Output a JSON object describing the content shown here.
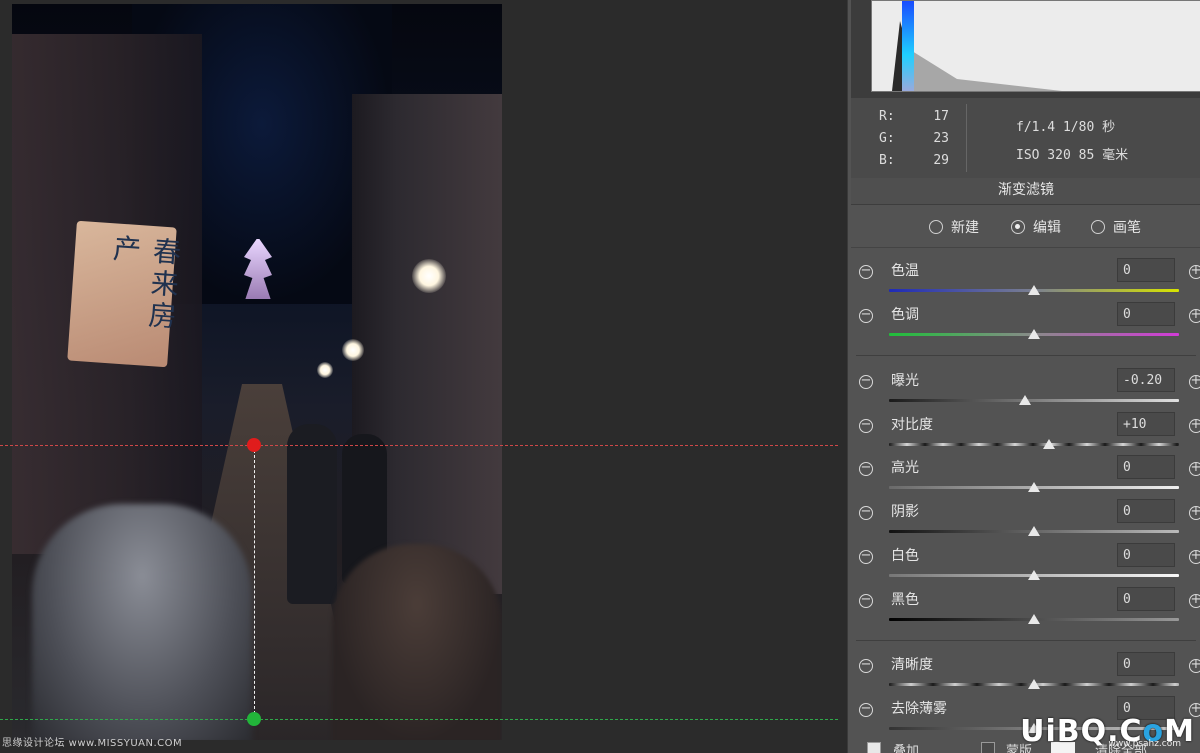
{
  "photo": {
    "sign_text": "春来房产",
    "bottom_watermark": "思缘设计论坛 www.MISSYUAN.COM"
  },
  "info": {
    "rgb": [
      {
        "label": "R:",
        "value": "17"
      },
      {
        "label": "G:",
        "value": "23"
      },
      {
        "label": "B:",
        "value": "29"
      }
    ],
    "exif_line1": "f/1.4  1/80 秒",
    "exif_line2": "ISO 320  85 毫米"
  },
  "panel": {
    "title": "渐变滤镜",
    "modes": [
      {
        "label": "新建",
        "selected": false
      },
      {
        "label": "编辑",
        "selected": true
      },
      {
        "label": "画笔",
        "selected": false
      }
    ],
    "sliders": [
      {
        "label": "色温",
        "value": "0",
        "fraction": 0.5
      },
      {
        "label": "色调",
        "value": "0",
        "fraction": 0.5
      },
      {
        "label": "曝光",
        "value": "-0.20",
        "fraction": 0.47
      },
      {
        "label": "对比度",
        "value": "+10",
        "fraction": 0.55
      },
      {
        "label": "高光",
        "value": "0",
        "fraction": 0.5
      },
      {
        "label": "阴影",
        "value": "0",
        "fraction": 0.5
      },
      {
        "label": "白色",
        "value": "0",
        "fraction": 0.5
      },
      {
        "label": "黑色",
        "value": "0",
        "fraction": 0.5
      },
      {
        "label": "清晰度",
        "value": "0",
        "fraction": 0.5
      },
      {
        "label": "去除薄雾",
        "value": "0",
        "fraction": 0.5
      }
    ],
    "bottom": {
      "overlay_label": "叠加",
      "mask_label": "蒙版",
      "clear_label": "清除全部"
    }
  },
  "logo": {
    "main": "UiBQ.CoM",
    "sub": "www.psahz.com"
  },
  "colors": {
    "red_pin": "#e01c1c",
    "green_pin": "#22b43a"
  }
}
